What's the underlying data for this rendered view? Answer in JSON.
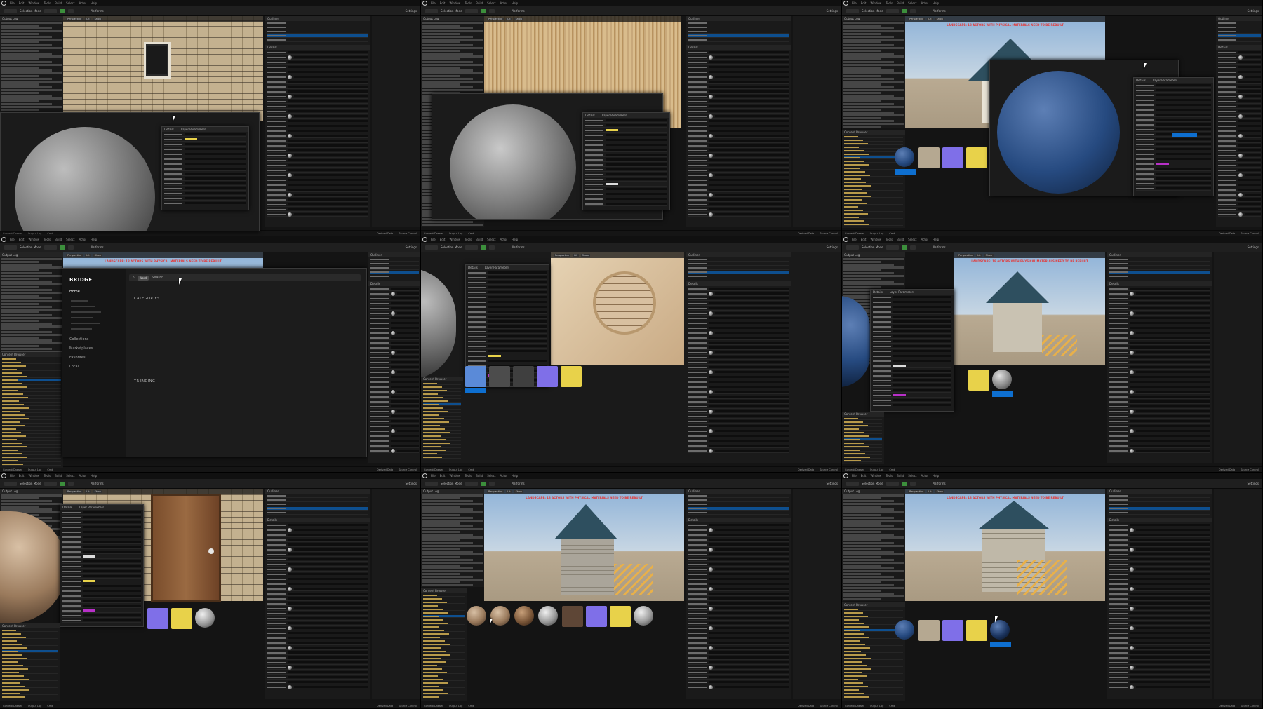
{
  "editor": {
    "menu_items": [
      "File",
      "Edit",
      "Window",
      "Tools",
      "Build",
      "Select",
      "Actor",
      "Help"
    ],
    "toolbar": {
      "mode_label": "Selection Mode",
      "platforms_label": "Platforms",
      "settings_label": "Settings"
    },
    "viewport": {
      "perspective_label": "Perspective",
      "lit_label": "Lit",
      "show_label": "Show"
    },
    "warning_text": "LANDSCAPE: 18 ACTORS WITH PHYSICAL MATERIALS NEED TO BE REBUILT",
    "panels": {
      "output_log": "Output Log",
      "outliner": "Outliner",
      "details": "Details",
      "layer_parameters": "Layer Parameters",
      "content_browser": "Content Browser"
    },
    "statusbar": {
      "content_drawer": "Content Drawer",
      "output_log": "Output Log",
      "cmd": "Cmd",
      "derived_data": "Derived Data",
      "source_control": "Source Control"
    },
    "colors": {
      "accent_blue": "#0e6fd0",
      "play_green": "#3c8f3c",
      "warning_red": "#e23b3b",
      "yellow_swatch": "#e8d24a",
      "magenta_swatch": "#b830c8"
    }
  },
  "bridge": {
    "logo": "BRIDGE",
    "search_filter": "Word",
    "search_placeholder": "Search",
    "nav": [
      "Home",
      "Collections",
      "Marketplaces",
      "Favorites",
      "Local"
    ],
    "sections": {
      "categories": "CATEGORIES",
      "trending": "TRENDING"
    }
  }
}
